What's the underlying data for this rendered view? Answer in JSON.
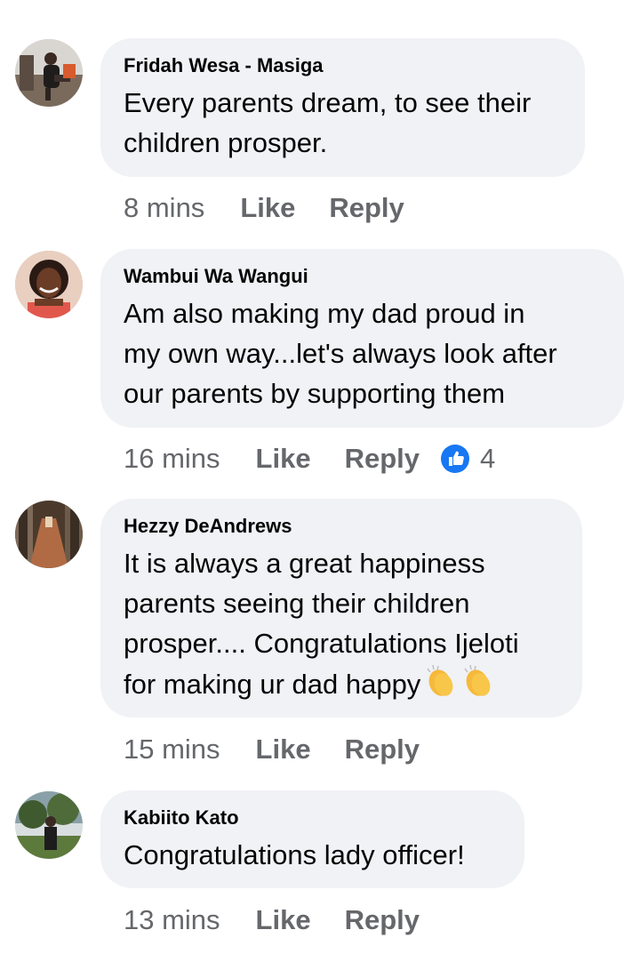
{
  "comments": [
    {
      "author": "Fridah Wesa - Masiga",
      "text": "Every parents dream, to see their\nchildren prosper.",
      "time": "8 mins",
      "like_label": "Like",
      "reply_label": "Reply"
    },
    {
      "author": "Wambui Wa Wangui",
      "text": "Am also making my dad proud in\nmy own way...let's always look after\nour parents by supporting them",
      "time": "16 mins",
      "like_label": "Like",
      "reply_label": "Reply",
      "reaction_icon": "like-thumb-icon",
      "reaction_count": "4"
    },
    {
      "author": "Hezzy DeAndrews",
      "text": "It is always a great happiness\nparents seeing their children\nprosper.... Congratulations Ijeloti\nfor making ur dad happy",
      "emoji": "clapping-hands-icon",
      "time": "15 mins",
      "like_label": "Like",
      "reply_label": "Reply"
    },
    {
      "author": "Kabiito Kato",
      "text": "Congratulations lady officer!",
      "time": "13 mins",
      "like_label": "Like",
      "reply_label": "Reply"
    }
  ],
  "colors": {
    "bubble_bg": "#f0f2f5",
    "meta_text": "#65676b",
    "like_blue": "#1877f2"
  }
}
